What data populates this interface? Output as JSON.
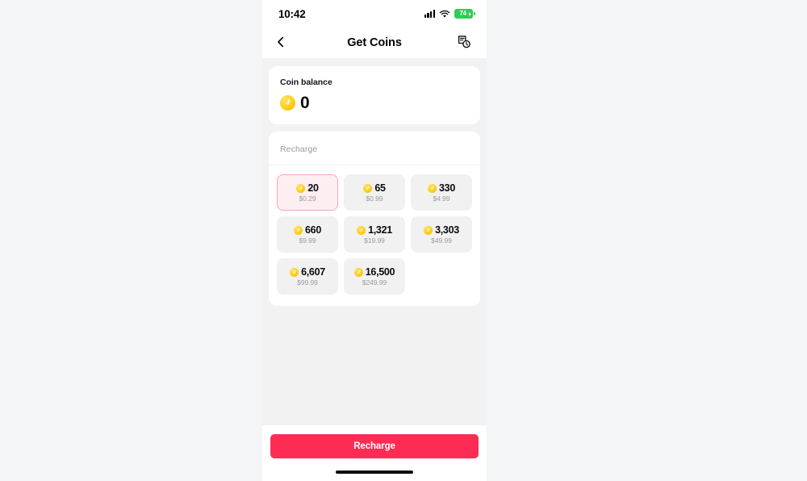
{
  "status_bar": {
    "time": "10:42",
    "signal_icon": "cellular-signal-icon",
    "wifi_icon": "wifi-icon",
    "battery_level": "74",
    "battery_icon": "battery-charging-icon",
    "battery_color": "#2ecc52"
  },
  "header": {
    "back_icon": "chevron-left-icon",
    "title": "Get Coins",
    "history_icon": "transaction-history-icon"
  },
  "balance": {
    "label": "Coin balance",
    "coin_icon": "tiktok-coin-icon",
    "value": "0"
  },
  "recharge": {
    "section_label": "Recharge",
    "coin_icon": "tiktok-coin-icon",
    "selected_index": 0,
    "accent_color": "#fe2c55",
    "selected_bg": "#fdeef2",
    "selected_border": "#f8a6bb",
    "options": [
      {
        "coins": "20",
        "price": "$0.29",
        "selected": true
      },
      {
        "coins": "65",
        "price": "$0.99",
        "selected": false
      },
      {
        "coins": "330",
        "price": "$4.99",
        "selected": false
      },
      {
        "coins": "660",
        "price": "$9.99",
        "selected": false
      },
      {
        "coins": "1,321",
        "price": "$19.99",
        "selected": false
      },
      {
        "coins": "3,303",
        "price": "$49.99",
        "selected": false
      },
      {
        "coins": "6,607",
        "price": "$99.99",
        "selected": false
      },
      {
        "coins": "16,500",
        "price": "$249.99",
        "selected": false
      }
    ]
  },
  "bottom_bar": {
    "recharge_button_label": "Recharge"
  }
}
